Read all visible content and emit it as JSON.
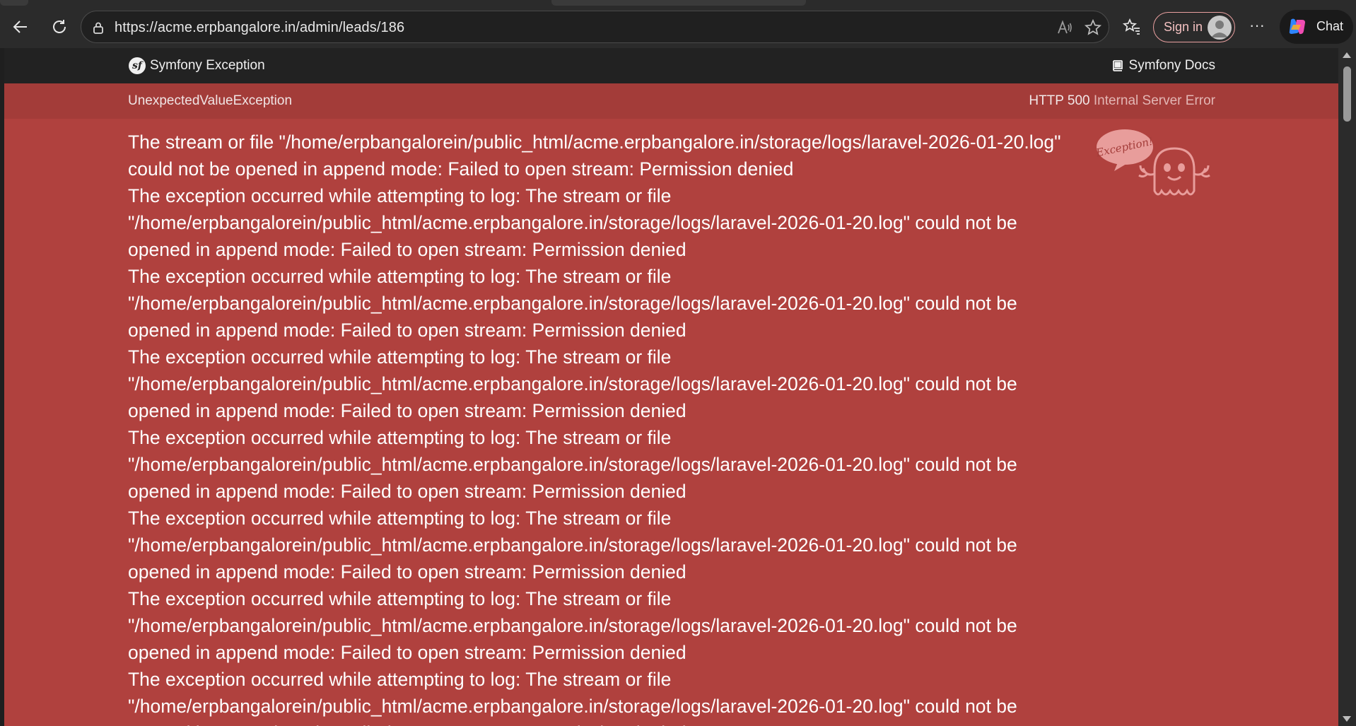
{
  "browser": {
    "url": "https://acme.erpbangalore.in/admin/leads/186",
    "signin_label": "Sign in",
    "chat_label": "Chat",
    "more_label": "···"
  },
  "header": {
    "brand": "Symfony Exception",
    "docs_label": "Symfony Docs"
  },
  "exception": {
    "class": "UnexpectedValueException",
    "status_code": "HTTP 500",
    "status_text": "Internal Server Error"
  },
  "message_lines": [
    "The stream or file \"/home/erpbangalorein/public_html/acme.erpbangalore.in/storage/logs/laravel-2026-01-20.log\"",
    "could not be opened in append mode: Failed to open stream: Permission denied",
    "The exception occurred while attempting to log: The stream or file",
    "\"/home/erpbangalorein/public_html/acme.erpbangalore.in/storage/logs/laravel-2026-01-20.log\" could not be",
    "opened in append mode: Failed to open stream: Permission denied",
    "The exception occurred while attempting to log: The stream or file",
    "\"/home/erpbangalorein/public_html/acme.erpbangalore.in/storage/logs/laravel-2026-01-20.log\" could not be",
    "opened in append mode: Failed to open stream: Permission denied",
    "The exception occurred while attempting to log: The stream or file",
    "\"/home/erpbangalorein/public_html/acme.erpbangalore.in/storage/logs/laravel-2026-01-20.log\" could not be",
    "opened in append mode: Failed to open stream: Permission denied",
    "The exception occurred while attempting to log: The stream or file",
    "\"/home/erpbangalorein/public_html/acme.erpbangalore.in/storage/logs/laravel-2026-01-20.log\" could not be",
    "opened in append mode: Failed to open stream: Permission denied",
    "The exception occurred while attempting to log: The stream or file",
    "\"/home/erpbangalorein/public_html/acme.erpbangalore.in/storage/logs/laravel-2026-01-20.log\" could not be",
    "opened in append mode: Failed to open stream: Permission denied",
    "The exception occurred while attempting to log: The stream or file",
    "\"/home/erpbangalorein/public_html/acme.erpbangalore.in/storage/logs/laravel-2026-01-20.log\" could not be",
    "opened in append mode: Failed to open stream: Permission denied",
    "The exception occurred while attempting to log: The stream or file",
    "\"/home/erpbangalorein/public_html/acme.erpbangalore.in/storage/logs/laravel-2026-01-20.log\" could not be",
    "opened in append mode: Failed to open stream: Permission denied"
  ],
  "ghost_badge": "Exception!",
  "icons": {
    "back": "back-arrow-icon",
    "refresh": "refresh-icon",
    "lock": "lock-icon",
    "read_aloud": "read-aloud-icon",
    "favorite": "star-icon",
    "favorites": "favorites-icon",
    "profile": "profile-icon",
    "copilot": "copilot-icon",
    "book": "book-icon",
    "ghost": "ghost-icon"
  },
  "colors": {
    "error_background": "#b0413e",
    "exception_bar": "#a33c39",
    "header_background": "#222222"
  }
}
